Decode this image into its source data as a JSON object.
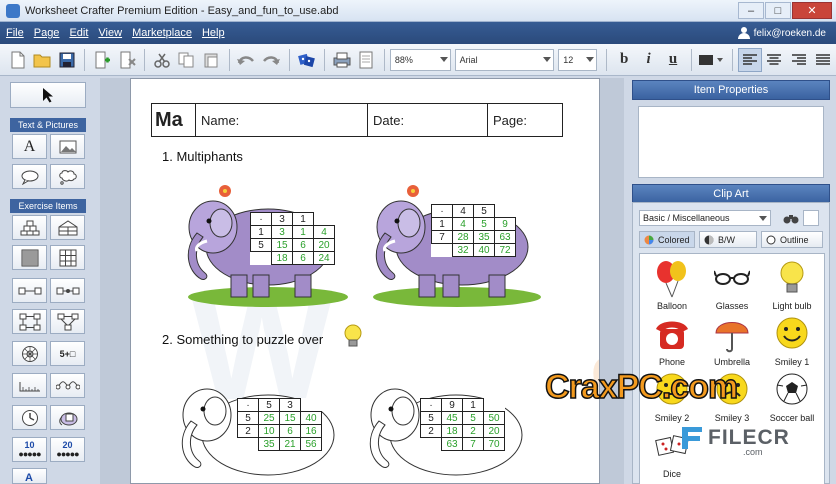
{
  "window": {
    "title": "Worksheet Crafter Premium Edition - Easy_and_fun_to_use.abd",
    "minimize": "–",
    "maximize": "□",
    "close": "✕"
  },
  "menu": [
    "File",
    "Page",
    "Edit",
    "View",
    "Marketplace",
    "Help"
  ],
  "user": {
    "name": "felix@roeken.de"
  },
  "toolbar": {
    "zoom": "88%",
    "font": "Arial",
    "size": "12",
    "bold": "b",
    "italic": "i",
    "underline": "u"
  },
  "left_panel": {
    "section_text": "Text & Pictures",
    "section_exercise": "Exercise Items",
    "text_tool": "A",
    "numbers_tool": "5+□",
    "dots10": "10",
    "dots20": "20"
  },
  "worksheet": {
    "header": {
      "ma": "Ma",
      "name": "Name:",
      "date": "Date:",
      "page": "Page:"
    },
    "q1": "1. Multiphants",
    "q2": "2. Something to puzzle over",
    "grid1": [
      [
        "·",
        "3",
        "1",
        ""
      ],
      [
        "1",
        "3",
        "1",
        "4"
      ],
      [
        "5",
        "15",
        "6",
        "20"
      ],
      [
        "",
        "18",
        "6",
        "24"
      ]
    ],
    "grid2": [
      [
        "·",
        "4",
        "5",
        ""
      ],
      [
        "1",
        "4",
        "5",
        "9"
      ],
      [
        "7",
        "28",
        "35",
        "63"
      ],
      [
        "",
        "32",
        "40",
        "72"
      ]
    ],
    "grid3": [
      [
        "·",
        "5",
        "3",
        ""
      ],
      [
        "5",
        "25",
        "15",
        "40"
      ],
      [
        "2",
        "10",
        "6",
        "16"
      ],
      [
        "",
        "35",
        "21",
        "56"
      ]
    ],
    "grid4": [
      [
        "·",
        "9",
        "1",
        ""
      ],
      [
        "5",
        "45",
        "5",
        "50"
      ],
      [
        "2",
        "18",
        "2",
        "20"
      ],
      [
        "",
        "63",
        "7",
        "70"
      ]
    ]
  },
  "right_panel": {
    "item_properties": "Item Properties",
    "clip_art": "Clip Art",
    "category": "Basic / Miscellaneous",
    "modes": [
      "Colored",
      "B/W",
      "Outline"
    ],
    "items": [
      "Balloon",
      "Glasses",
      "Light bulb",
      "Phone",
      "Umbrella",
      "Smiley 1",
      "Smiley 2",
      "Smiley 3",
      "Soccer ball",
      "Dice"
    ]
  },
  "watermark": {
    "crax": "CraxPC.com",
    "filecr": "FILECR",
    "filecr_com": ".com"
  },
  "colors": {
    "menubar": "#2b4a7b",
    "panel_header": "#3a62a0",
    "green_digits": "#2aa02a",
    "watermark_orange": "#f39a1e"
  }
}
